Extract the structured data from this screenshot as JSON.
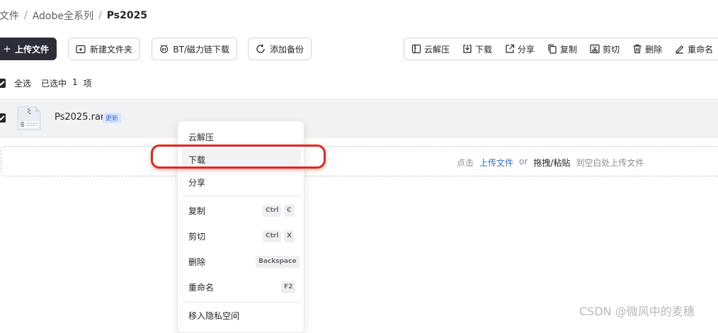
{
  "breadcrumb": {
    "items": [
      "文件",
      "Adobe全系列"
    ],
    "current": "Ps2025",
    "separator": "/"
  },
  "toolbar": {
    "upload_label": "上传文件",
    "new_folder_label": "新建文件夹",
    "bt_label": "BT/磁力链下载",
    "backup_label": "添加备份",
    "actions": {
      "extract": "云解压",
      "download": "下载",
      "share": "分享",
      "copy": "复制",
      "cut": "剪切",
      "delete": "删除",
      "rename": "重命名"
    }
  },
  "selection": {
    "select_all": "全选",
    "selected_prefix": "已选中",
    "count": "1",
    "unit": "项"
  },
  "file": {
    "name": "Ps2025.rar",
    "badge": "更新"
  },
  "upload_hint": {
    "prefix": "点击",
    "link": "上传文件",
    "or": "or",
    "drag": "拖拽/粘贴",
    "suffix": "到空白处上传文件"
  },
  "context_menu": {
    "extract": "云解压",
    "download": "下载",
    "share": "分享",
    "copy": "复制",
    "cut": "剪切",
    "delete": "删除",
    "rename": "重命名",
    "private": "移入隐私空间",
    "shortcuts": {
      "ctrl": "Ctrl",
      "c": "C",
      "x": "X",
      "backspace": "Backspace",
      "f2": "F2"
    }
  },
  "watermark": "CSDN @微风中的麦穗",
  "colors": {
    "primary_dark": "#2b2e38",
    "link_blue": "#2f6fdf",
    "highlight_red": "#e0281e",
    "badge_bg": "#dbe7ff"
  }
}
